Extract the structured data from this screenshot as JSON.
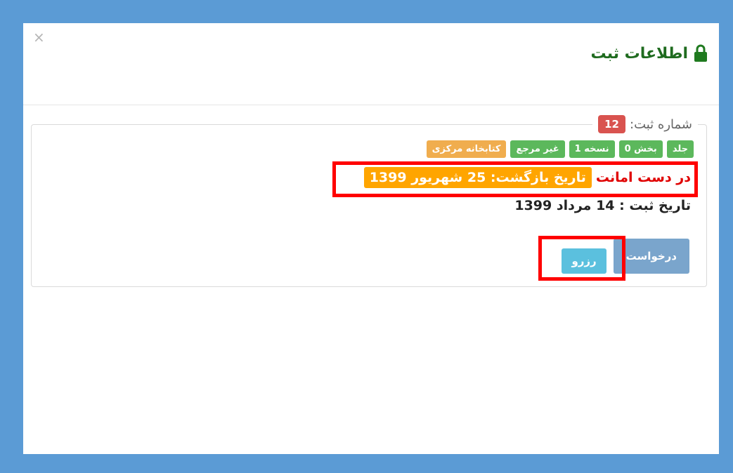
{
  "modal": {
    "close_label": "×",
    "title": "اطلاعات ثبت",
    "title_icon": "lock-icon"
  },
  "fieldset": {
    "legend_label": "شماره ثبت:",
    "record_number": "12"
  },
  "tags": [
    {
      "label": "جلد",
      "color": "#5cb85c"
    },
    {
      "label": "بخش 0",
      "color": "#5cb85c"
    },
    {
      "label": "نسخه 1",
      "color": "#5cb85c"
    },
    {
      "label": "غیر مرجع",
      "color": "#5cb85c"
    },
    {
      "label": "کتابخانه مرکزی",
      "color": "#f0ad4e"
    }
  ],
  "status": {
    "loan_status": "در دست امانت",
    "return_date": "تاریخ بازگشت: 25 شهریور 1399"
  },
  "registration": {
    "date_text": "تاریخ ثبت : 14 مرداد 1399"
  },
  "actions": {
    "request_label": "درخواست",
    "reserve_label": "رزرو"
  },
  "colors": {
    "background": "#5b9bd5",
    "title_green": "#1f6b1f",
    "status_red": "#e00000",
    "badge_red": "#d9534f",
    "return_orange": "#ffa500",
    "highlight_red": "#ff0000"
  }
}
